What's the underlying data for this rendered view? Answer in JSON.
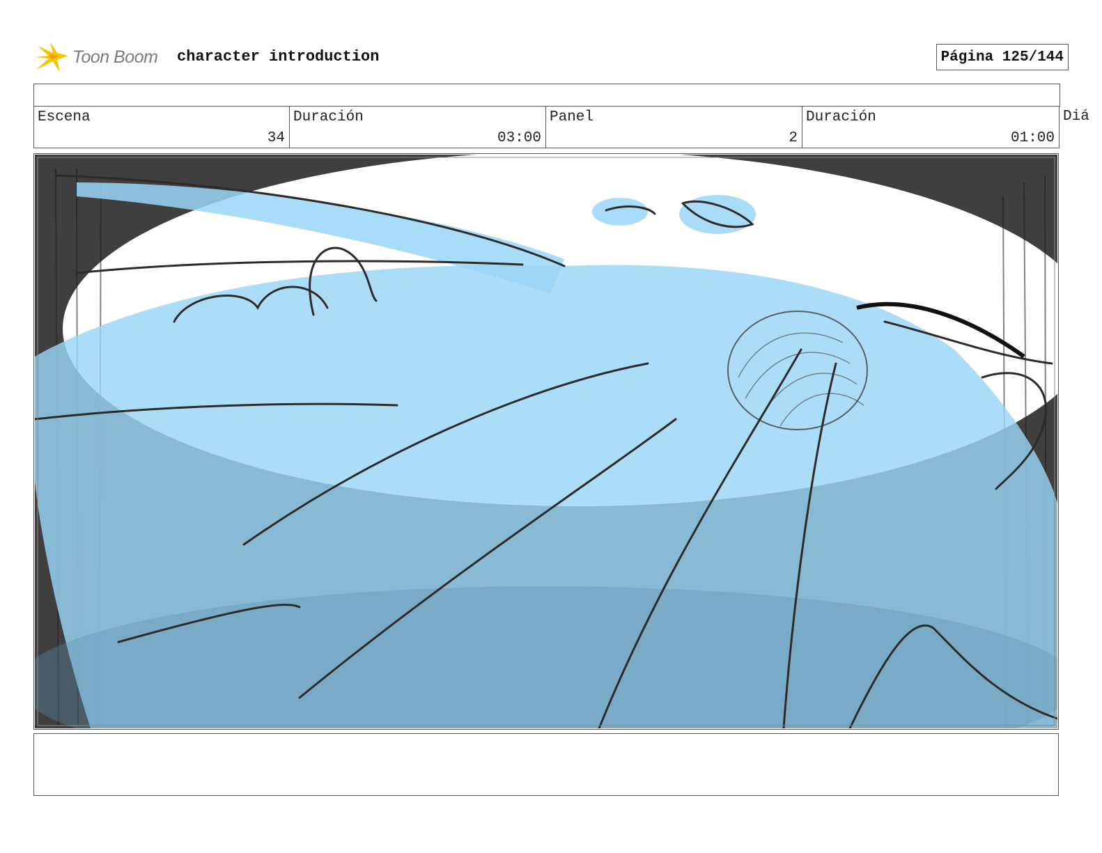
{
  "header": {
    "logo_text": "Toon Boom",
    "project_title": "character introduction",
    "page_label": "Página 125/144"
  },
  "info": {
    "scene_label": "Escena",
    "scene_value": "34",
    "scene_duration_label": "Duración",
    "scene_duration_value": "03:00",
    "panel_label": "Panel",
    "panel_value": "2",
    "panel_duration_label": "Duración",
    "panel_duration_value": "01:00",
    "dialog_label": "Diá"
  },
  "notes": {
    "text": ""
  },
  "colors": {
    "sketch_blue": "#9ad6f7",
    "shadow_gray": "#3f3f3f",
    "line": "#2b2b2b",
    "logo_yellow": "#f7c400"
  },
  "icons": {
    "logo": "toon-boom-star-icon"
  }
}
